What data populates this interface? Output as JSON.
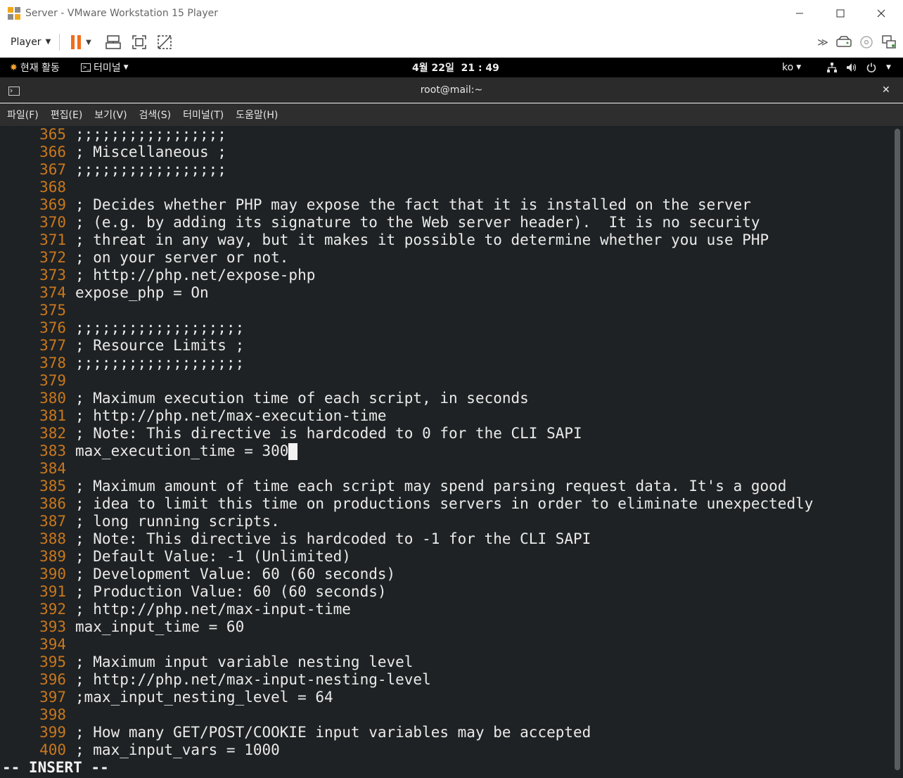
{
  "window": {
    "title": "Server - VMware Workstation 15 Player",
    "player_menu": "Player"
  },
  "gnome": {
    "activities": "현재 활동",
    "app_menu": "터미널",
    "clock": "4월 22일  21 : 49",
    "language": "ko"
  },
  "terminal": {
    "title": "root@mail:~",
    "menu": [
      "파일(F)",
      "편집(E)",
      "보기(V)",
      "검색(S)",
      "터미널(T)",
      "도움말(H)"
    ],
    "status": "-- INSERT --",
    "lines": [
      {
        "n": "365",
        "t": ";;;;;;;;;;;;;;;;;"
      },
      {
        "n": "366",
        "t": "; Miscellaneous ;"
      },
      {
        "n": "367",
        "t": ";;;;;;;;;;;;;;;;;"
      },
      {
        "n": "368",
        "t": ""
      },
      {
        "n": "369",
        "t": "; Decides whether PHP may expose the fact that it is installed on the server"
      },
      {
        "n": "370",
        "t": "; (e.g. by adding its signature to the Web server header).  It is no security"
      },
      {
        "n": "371",
        "t": "; threat in any way, but it makes it possible to determine whether you use PHP"
      },
      {
        "n": "372",
        "t": "; on your server or not."
      },
      {
        "n": "373",
        "t": "; http://php.net/expose-php"
      },
      {
        "n": "374",
        "t": "expose_php = On"
      },
      {
        "n": "375",
        "t": ""
      },
      {
        "n": "376",
        "t": ";;;;;;;;;;;;;;;;;;;"
      },
      {
        "n": "377",
        "t": "; Resource Limits ;"
      },
      {
        "n": "378",
        "t": ";;;;;;;;;;;;;;;;;;;"
      },
      {
        "n": "379",
        "t": ""
      },
      {
        "n": "380",
        "t": "; Maximum execution time of each script, in seconds"
      },
      {
        "n": "381",
        "t": "; http://php.net/max-execution-time"
      },
      {
        "n": "382",
        "t": "; Note: This directive is hardcoded to 0 for the CLI SAPI"
      },
      {
        "n": "383",
        "t": "max_execution_time = 300",
        "cursor": true
      },
      {
        "n": "384",
        "t": ""
      },
      {
        "n": "385",
        "t": "; Maximum amount of time each script may spend parsing request data. It's a good"
      },
      {
        "n": "386",
        "t": "; idea to limit this time on productions servers in order to eliminate unexpectedly"
      },
      {
        "n": "387",
        "t": "; long running scripts."
      },
      {
        "n": "388",
        "t": "; Note: This directive is hardcoded to -1 for the CLI SAPI"
      },
      {
        "n": "389",
        "t": "; Default Value: -1 (Unlimited)"
      },
      {
        "n": "390",
        "t": "; Development Value: 60 (60 seconds)"
      },
      {
        "n": "391",
        "t": "; Production Value: 60 (60 seconds)"
      },
      {
        "n": "392",
        "t": "; http://php.net/max-input-time"
      },
      {
        "n": "393",
        "t": "max_input_time = 60"
      },
      {
        "n": "394",
        "t": ""
      },
      {
        "n": "395",
        "t": "; Maximum input variable nesting level"
      },
      {
        "n": "396",
        "t": "; http://php.net/max-input-nesting-level"
      },
      {
        "n": "397",
        "t": ";max_input_nesting_level = 64"
      },
      {
        "n": "398",
        "t": ""
      },
      {
        "n": "399",
        "t": "; How many GET/POST/COOKIE input variables may be accepted"
      },
      {
        "n": "400",
        "t": "; max_input_vars = 1000"
      }
    ]
  }
}
